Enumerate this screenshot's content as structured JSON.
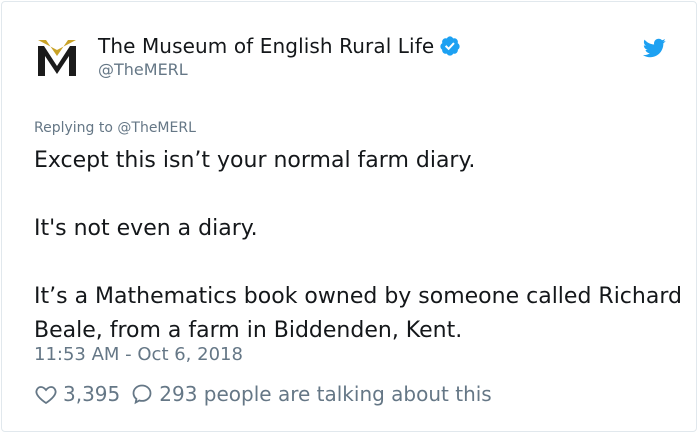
{
  "tweet": {
    "display_name": "The Museum of English Rural Life",
    "handle": "@TheMERL",
    "avatar_letter": "M",
    "replying_prefix": "Replying to",
    "replying_handle": "@TheMERL",
    "paragraphs": [
      "Except this isn’t your normal farm diary.",
      "It's not even a diary.",
      "It’s a Mathematics book owned by someone called Richard Beale, from a farm in Biddenden, Kent."
    ],
    "timestamp": "11:53 AM - Oct 6, 2018",
    "likes": "3,395",
    "talking": "293 people are talking about this"
  },
  "colors": {
    "twitter_blue": "#1da1f2",
    "text": "#14171a",
    "muted": "#657786",
    "avatar_gold": "#c9a227"
  },
  "icons": {
    "verified": "verified-badge-icon",
    "bird": "twitter-bird-icon",
    "heart": "heart-icon",
    "reply": "speech-bubble-icon"
  }
}
